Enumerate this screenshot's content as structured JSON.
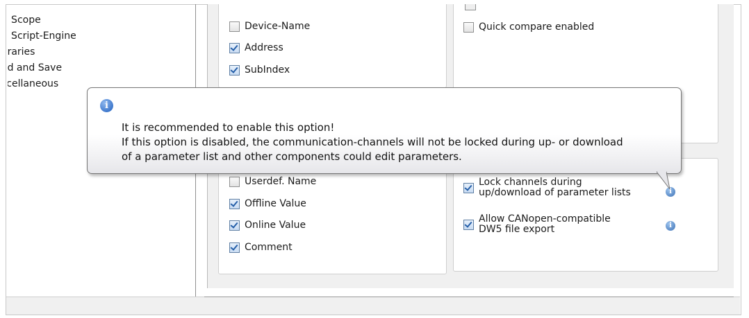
{
  "sidebar": {
    "items": [
      {
        "label": "B Scope"
      },
      {
        "label": "B Script-Engine"
      },
      {
        "label": "oraries"
      },
      {
        "label": "ad and Save"
      },
      {
        "label": "scellaneous"
      }
    ]
  },
  "group_columns_top": {
    "items": [
      {
        "label": "Device-Name",
        "checked": false
      },
      {
        "label": "Address",
        "checked": true
      },
      {
        "label": "SubIndex",
        "checked": true
      }
    ]
  },
  "group_compare": {
    "quick_compare": {
      "label": "Quick compare enabled",
      "checked": false
    }
  },
  "group_columns_bottom": {
    "items": [
      {
        "label": "Userdef. Name",
        "checked": false
      },
      {
        "label": "Offline Value",
        "checked": true
      },
      {
        "label": "Online Value",
        "checked": true
      },
      {
        "label": "Comment",
        "checked": true
      }
    ]
  },
  "group_options": {
    "lock_channels": {
      "line1": "Lock channels during",
      "line2": "up/download of parameter lists",
      "checked": true,
      "icon": "info-icon"
    },
    "allow_export": {
      "line1": "Allow  CANopen-compatible",
      "line2": "DW5 file export",
      "checked": true,
      "icon": "info-icon"
    }
  },
  "tooltip": {
    "icon": "info-icon",
    "line1": "It is recommended to enable this option!",
    "line2": "If this option is disabled, the communication-channels will not be locked during up- or download",
    "line3": "of a parameter list and other components could edit parameters."
  },
  "colors": {
    "accent": "#245ea8",
    "panel_bg": "#f0f0f0",
    "tooltip_border": "#767676"
  }
}
